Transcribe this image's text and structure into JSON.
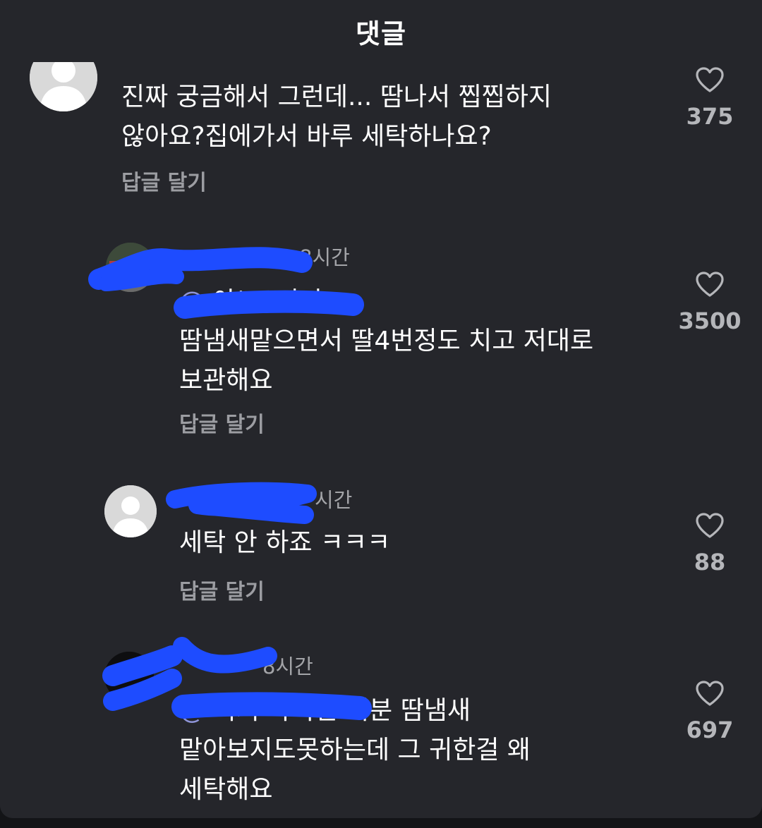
{
  "header": {
    "title": "댓글"
  },
  "colors": {
    "background": "#25262b",
    "text": "#ffffff",
    "muted": "#a3a4a8",
    "mention": "#8f95d9",
    "redaction": "#1e4cff"
  },
  "comments": [
    {
      "avatar": "default-avatar",
      "text": "진짜 궁금해서 그런데... 땀나서 찝찝하지\n않아요?집에가서 바루 세탁하나요?",
      "reply_label": "답글 달기",
      "likes": "375",
      "like_icon": "heart-outline-icon"
    },
    {
      "avatar": "photo-avatar",
      "time": "8시간",
      "text": "아뇨..저거\n땀냄새맡으면서 딸4번정도 치고 저대로\n보관해요",
      "reply_label": "답글 달기",
      "likes": "3500",
      "like_icon": "heart-outline-icon"
    },
    {
      "avatar": "default-avatar",
      "time": "시간",
      "text": "세탁 안 하죠 ㅋㅋㅋ",
      "reply_label": "답글 달기",
      "likes": "88",
      "like_icon": "heart-outline-icon"
    },
    {
      "avatar": "photo-avatar",
      "time": "8시간",
      "text": "이거 아니면 저분 땀냄새\n맡아보지도못하는데 그 귀한걸 왜\n세탁해요",
      "likes": "697",
      "like_icon": "heart-outline-icon"
    }
  ]
}
